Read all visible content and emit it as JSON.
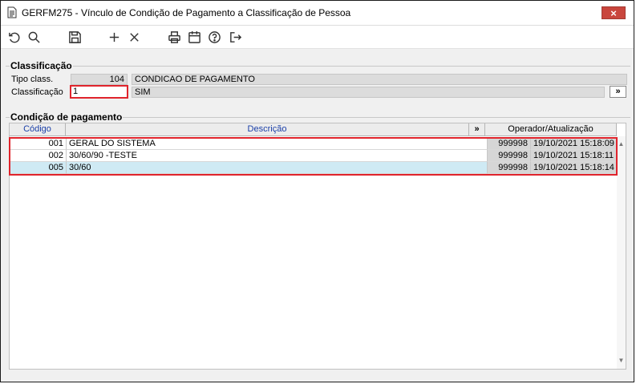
{
  "window": {
    "title": "GERFM275 - Vínculo de Condição de Pagamento a Classificação de Pessoa",
    "close_label": "×"
  },
  "toolbar": {
    "buttons": [
      "refresh-icon",
      "search-icon",
      "save-icon",
      "add-icon",
      "delete-icon",
      "print-icon",
      "calendar-icon",
      "help-icon",
      "exit-icon"
    ]
  },
  "classificacao": {
    "section_title": "Classificação",
    "tipo_label": "Tipo class.",
    "tipo_code": "104",
    "tipo_desc": "CONDICAO DE PAGAMENTO",
    "class_label": "Classificação",
    "class_value": "1",
    "class_desc": "SIM",
    "lookup_label": "»"
  },
  "condicao": {
    "section_title": "Condição de pagamento",
    "columns": {
      "codigo": "Código",
      "descricao": "Descrição",
      "expand": "»",
      "operador": "Operador/Atualização"
    },
    "rows": [
      {
        "codigo": "001",
        "descricao": "GERAL DO SISTEMA",
        "operador": "999998",
        "atualizacao": "19/10/2021 15:18:09"
      },
      {
        "codigo": "002",
        "descricao": "30/60/90 -TESTE",
        "operador": "999998",
        "atualizacao": "19/10/2021 15:18:11"
      },
      {
        "codigo": "005",
        "descricao": "30/60",
        "operador": "999998",
        "atualizacao": "19/10/2021 15:18:14"
      }
    ]
  },
  "colors": {
    "accent_red": "#e0242c",
    "header_blue": "#1a3fa8",
    "selected_row": "#cfeaf4"
  }
}
